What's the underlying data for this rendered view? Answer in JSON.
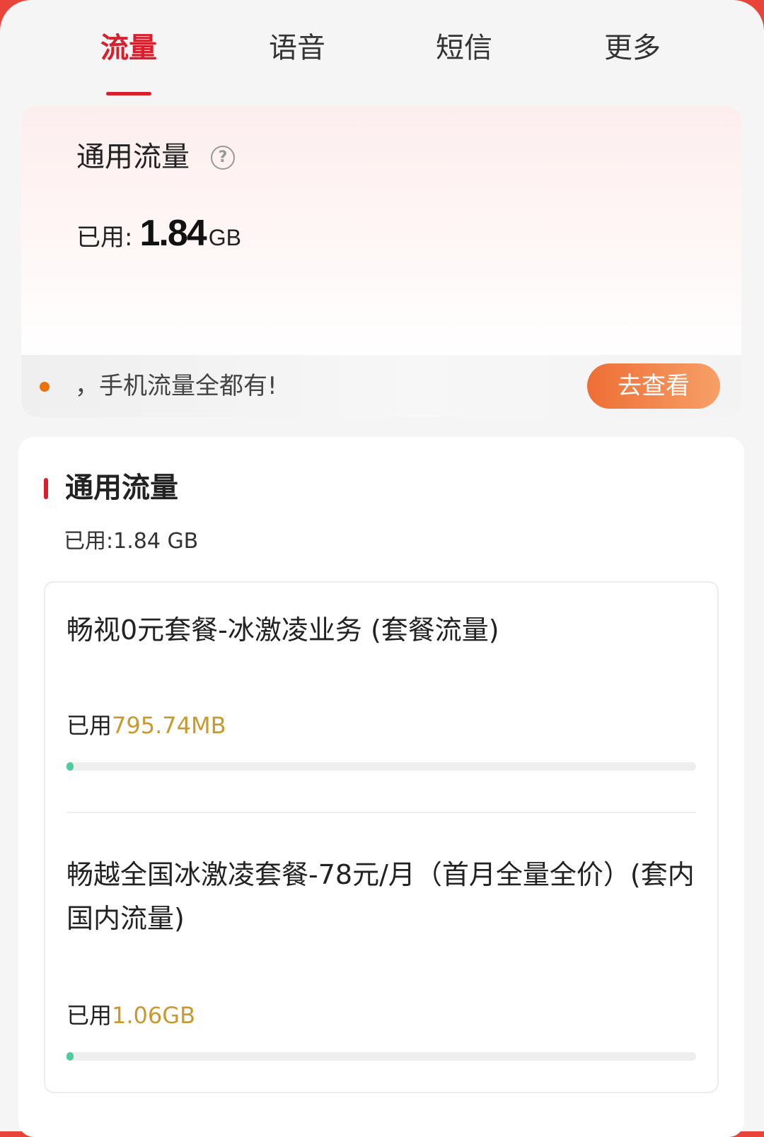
{
  "tabs": [
    {
      "label": "流量",
      "active": true
    },
    {
      "label": "语音",
      "active": false
    },
    {
      "label": "短信",
      "active": false
    },
    {
      "label": "更多",
      "active": false
    }
  ],
  "summary": {
    "title": "通用流量",
    "used_label": "已用:",
    "used_value": "1.84",
    "used_unit": "GB",
    "promo_text": "，手机流量全都有!",
    "promo_button": "去查看"
  },
  "detail": {
    "section_title": "通用流量",
    "section_used": "已用:1.84 GB",
    "packages": [
      {
        "name": "畅视0元套餐-冰激凌业务 (套餐流量)",
        "used_label": "已用",
        "used_amount": "795.74MB",
        "progress_fraction": 0.01
      },
      {
        "name": "畅越全国冰激凌套餐-78元/月（首月全量全价）(套内国内流量)",
        "used_label": "已用",
        "used_amount": "1.06GB",
        "progress_fraction": 0.01
      }
    ]
  },
  "colors": {
    "accent": "#d6202e",
    "amount": "#c9992f",
    "progress": "#4fcb9d",
    "promo_dot": "#e8730c"
  },
  "icons": {
    "help": "question-circle-icon"
  }
}
